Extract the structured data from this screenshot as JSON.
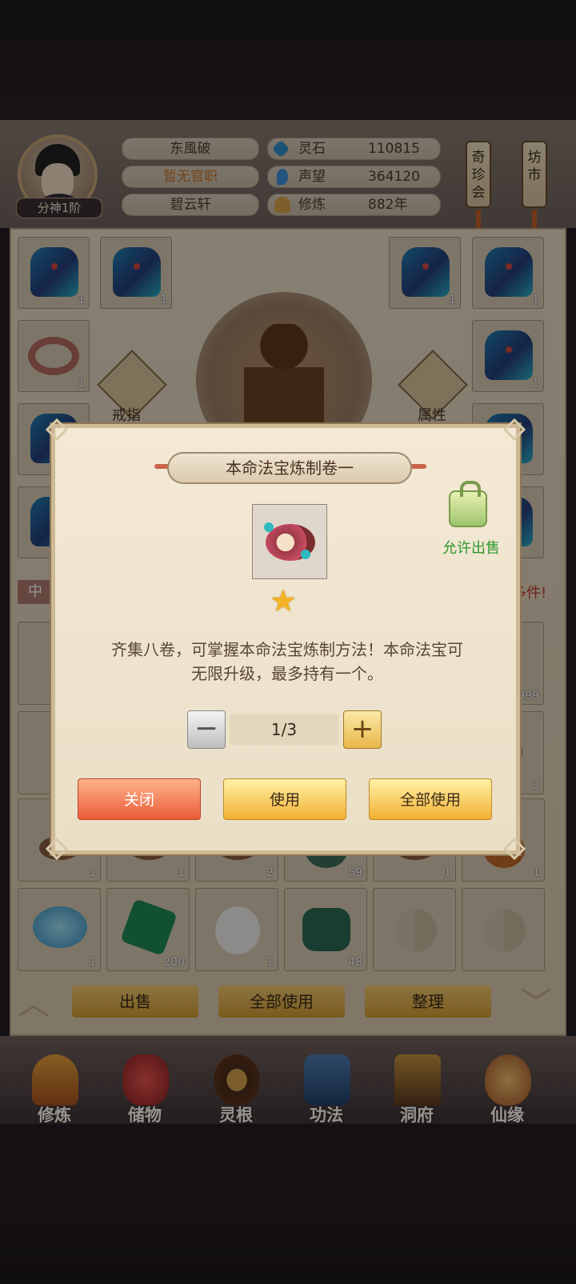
{
  "player": {
    "name": "东風破",
    "office": "暂无官职",
    "sect": "碧云轩",
    "rank": "分神1阶"
  },
  "resources": {
    "spirit_stone": {
      "label": "灵石",
      "value": "110815"
    },
    "reputation": {
      "label": "声望",
      "value": "364120"
    },
    "cultivation": {
      "label": "修炼",
      "value": "882年"
    }
  },
  "lanterns": {
    "treasure_fair": "奇珍会",
    "market": "坊市"
  },
  "inventory": {
    "equip_counts": [
      "1",
      "1",
      "1",
      "1",
      "1",
      "1"
    ],
    "ring_label": "戒指",
    "attr_label": "属性",
    "left_tag": "中",
    "right_tag": "多件!",
    "row_counts": [
      "999",
      "3",
      "1",
      "1",
      "2",
      "59",
      "1",
      "1",
      "1",
      "200",
      "1",
      "48"
    ],
    "actions": {
      "sell": "出售",
      "use_all": "全部使用",
      "sort": "整理"
    }
  },
  "nav": [
    {
      "label": "修炼",
      "icon": "monk-icon"
    },
    {
      "label": "储物",
      "icon": "pouch-icon"
    },
    {
      "label": "灵根",
      "icon": "root-icon"
    },
    {
      "label": "功法",
      "icon": "book-icon"
    },
    {
      "label": "洞府",
      "icon": "cave-icon"
    },
    {
      "label": "仙缘",
      "icon": "gourd-icon"
    }
  ],
  "dialog": {
    "title": "本命法宝炼制卷一",
    "stars": 1,
    "sell_status": "允许出售",
    "description_line1": "齐集八卷，可掌握本命法宝炼制方法！本命法宝可",
    "description_line2": "无限升级，最多持有一个。",
    "quantity": "1/3",
    "close_label": "关闭",
    "use_label": "使用",
    "use_all_label": "全部使用"
  }
}
